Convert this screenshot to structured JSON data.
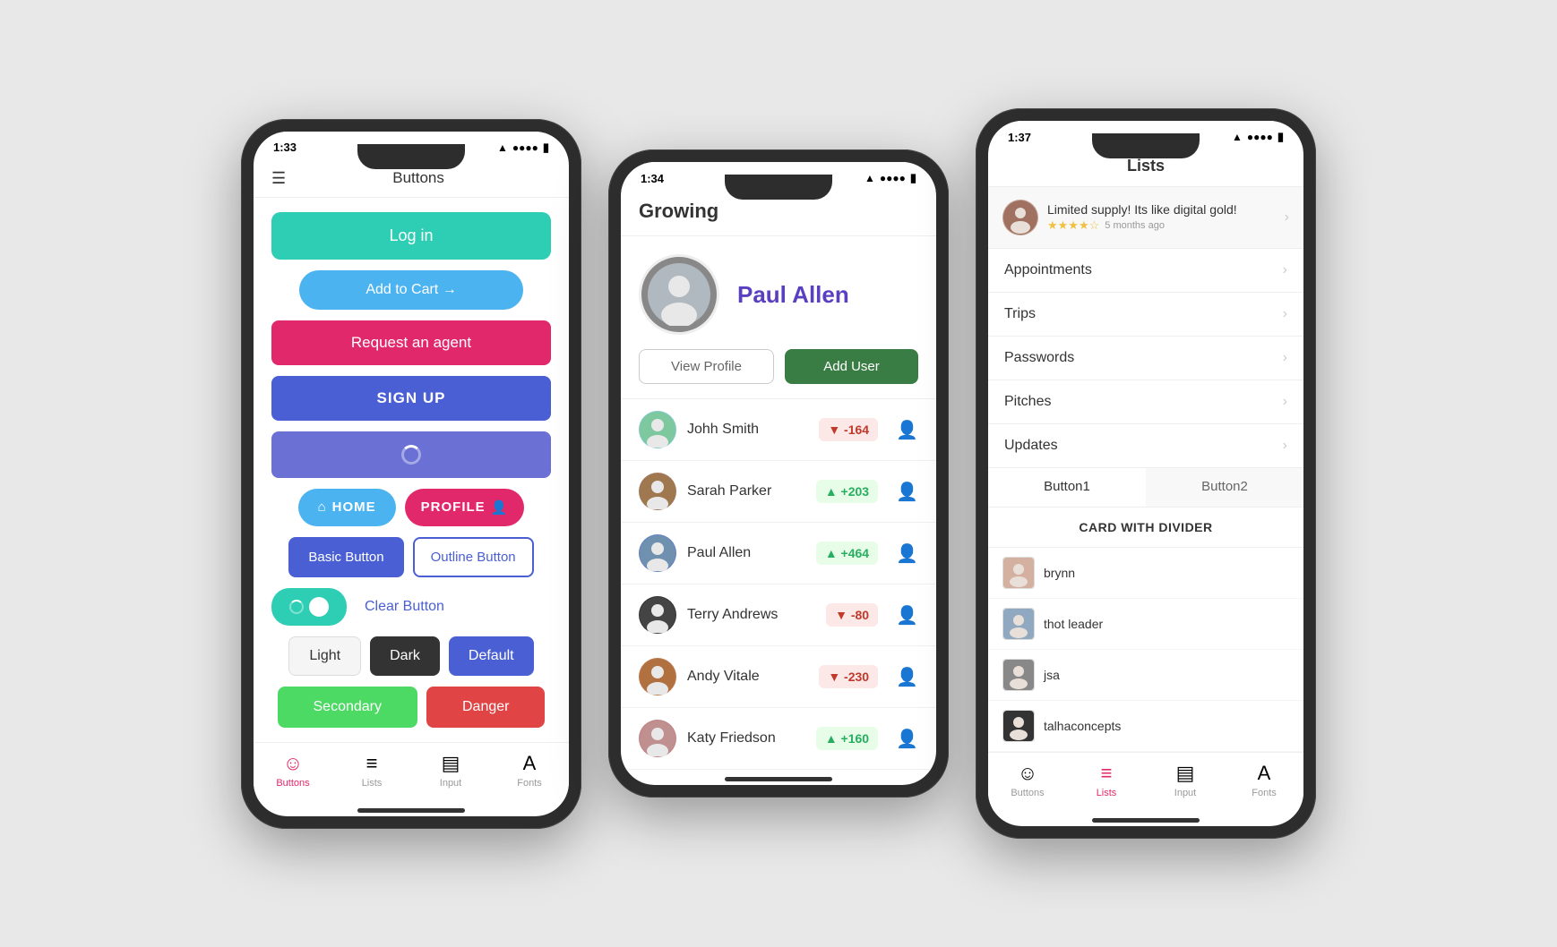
{
  "phone1": {
    "time": "1:33",
    "title": "Buttons",
    "buttons": {
      "login": "Log in",
      "addToCart": "Add to Cart →",
      "requestAgent": "Request an agent",
      "signUp": "SIGN UP",
      "home": "HOME",
      "profile": "PROFILE",
      "basicButton": "Basic Button",
      "outlineButton": "Outline Button",
      "clearButton": "Clear Button",
      "light": "Light",
      "dark": "Dark",
      "default": "Default",
      "secondary": "Secondary",
      "danger": "Danger"
    },
    "nav": {
      "buttons": "Buttons",
      "lists": "Lists",
      "input": "Input",
      "fonts": "Fonts"
    }
  },
  "phone2": {
    "time": "1:34",
    "appTitle": "Growing",
    "profile": {
      "name": "Paul Allen"
    },
    "buttons": {
      "viewProfile": "View Profile",
      "addUser": "Add User"
    },
    "users": [
      {
        "name": "Johh Smith",
        "score": "-164",
        "positive": false
      },
      {
        "name": "Sarah Parker",
        "score": "+203",
        "positive": true
      },
      {
        "name": "Paul Allen",
        "score": "+464",
        "positive": true
      },
      {
        "name": "Terry Andrews",
        "score": "-80",
        "positive": false
      },
      {
        "name": "Andy Vitale",
        "score": "-230",
        "positive": false
      },
      {
        "name": "Katy Friedson",
        "score": "+160",
        "positive": true
      }
    ]
  },
  "phone3": {
    "time": "1:37",
    "title": "Lists",
    "review": {
      "text": "Limited supply! Its like digital gold!",
      "stars": "★★★★☆",
      "time": "5 months ago"
    },
    "listItems": [
      "Appointments",
      "Trips",
      "Passwords",
      "Pitches",
      "Updates"
    ],
    "tabs": {
      "button1": "Button1",
      "button2": "Button2"
    },
    "card": {
      "title": "CARD WITH DIVIDER",
      "users": [
        "brynn",
        "thot leader",
        "jsa",
        "talhaconcepts"
      ]
    },
    "nav": {
      "buttons": "Buttons",
      "lists": "Lists",
      "input": "Input",
      "fonts": "Fonts"
    }
  }
}
